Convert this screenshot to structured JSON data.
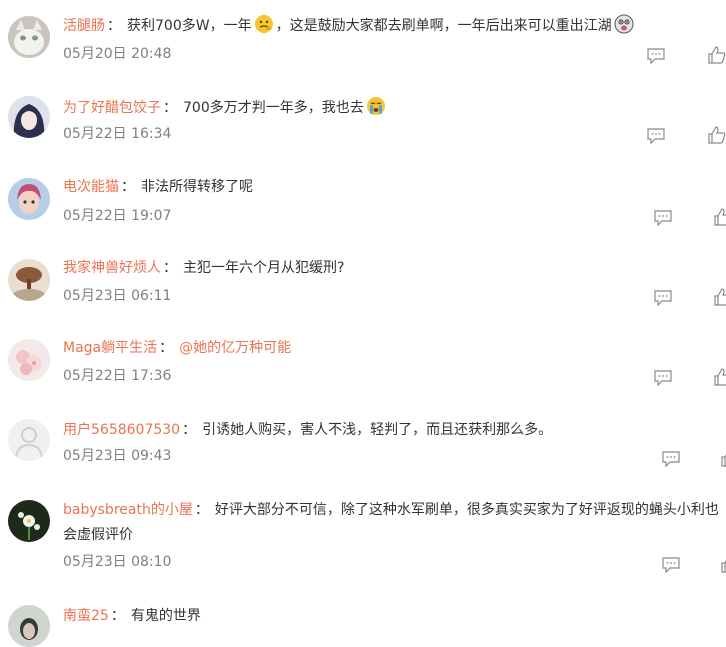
{
  "comments": [
    {
      "user": "活腿肠",
      "sep": "：",
      "text_a": "获利700多W，一年",
      "text_b": "，这是鼓励大家都去刷单啊，一年后出来可以重出江湖",
      "time": "05月20日 20:48",
      "emoji_a": "thinking-emoji",
      "emoji_b": "tongue-emoji"
    },
    {
      "user": "为了好醋包饺子",
      "sep": "：",
      "text_a": "700多万才判一年多，我也去",
      "time": "05月22日 16:34",
      "emoji_a": "crying-emoji"
    },
    {
      "user": "电次能猫",
      "sep": "：",
      "text_a": "非法所得转移了呢",
      "time": "05月22日 19:07"
    },
    {
      "user": "我家神兽好烦人",
      "sep": "：",
      "text_a": "主犯一年六个月从犯缓刑?",
      "time": "05月23日 06:11"
    },
    {
      "user": "Maga躺平生活",
      "sep": "：",
      "mention": "@她的亿万种可能",
      "time": "05月22日 17:36"
    },
    {
      "user": "用户5658607530",
      "sep": "：",
      "text_a": "引诱她人购买，害人不浅，轻判了，而且还获利那么多。",
      "time": "05月23日 09:43"
    },
    {
      "user": "babysbreath的小屋",
      "sep": "：",
      "text_a": "好评大部分不可信，除了这种水军刷单，很多真实买家为了好评返现的蝇头小利也",
      "text_b": "会虚假评价",
      "time": "05月23日 08:10"
    },
    {
      "user": "南蛮25",
      "sep": "：",
      "text_a": "有鬼的世界"
    }
  ],
  "colors": {
    "username": "#eb7350",
    "text": "#333333",
    "time": "#808080",
    "icon": "#8a8a8a"
  }
}
